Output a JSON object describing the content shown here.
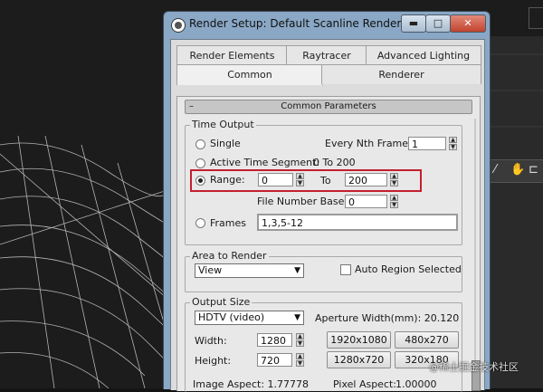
{
  "window": {
    "title": "Render Setup: Default Scanline Renderer",
    "controls": {
      "minimize": "▬",
      "maximize": "□",
      "close": "✕"
    }
  },
  "tabs": {
    "render_elements": "Render Elements",
    "raytracer": "Raytracer",
    "advanced_lighting": "Advanced Lighting",
    "common": "Common",
    "renderer": "Renderer"
  },
  "rollout": {
    "title": "Common Parameters",
    "toggle": "–"
  },
  "time_output": {
    "label": "Time Output",
    "single": "Single",
    "every_nth_label": "Every Nth Frame:",
    "every_nth_value": "1",
    "active_time_segment": "Active Time Segment:",
    "active_time_value": "0 To 200",
    "range": "Range:",
    "range_start": "0",
    "range_to": "To",
    "range_end": "200",
    "file_number_base_label": "File Number Base:",
    "file_number_base_value": "0",
    "frames": "Frames",
    "frames_value": "1,3,5-12",
    "selected": "range"
  },
  "area_to_render": {
    "label": "Area to Render",
    "selected": "View",
    "auto_region_label": "Auto Region Selected",
    "auto_region_checked": false
  },
  "output_size": {
    "label": "Output Size",
    "preset": "HDTV (video)",
    "aperture_label": "Aperture Width(mm): 20.120",
    "width_label": "Width:",
    "width_value": "1280",
    "height_label": "Height:",
    "height_value": "720",
    "presets": [
      "1920x1080",
      "480x270",
      "1280x720",
      "320x180"
    ],
    "image_aspect": "Image Aspect: 1.77778",
    "pixel_aspect_label": "Pixel Aspect:",
    "pixel_aspect_value": "1.00000"
  },
  "watermark": "@稀土掘金技术社区",
  "colors": {
    "highlight": "#c41f2e",
    "title_bar": "#8aa8c6"
  }
}
